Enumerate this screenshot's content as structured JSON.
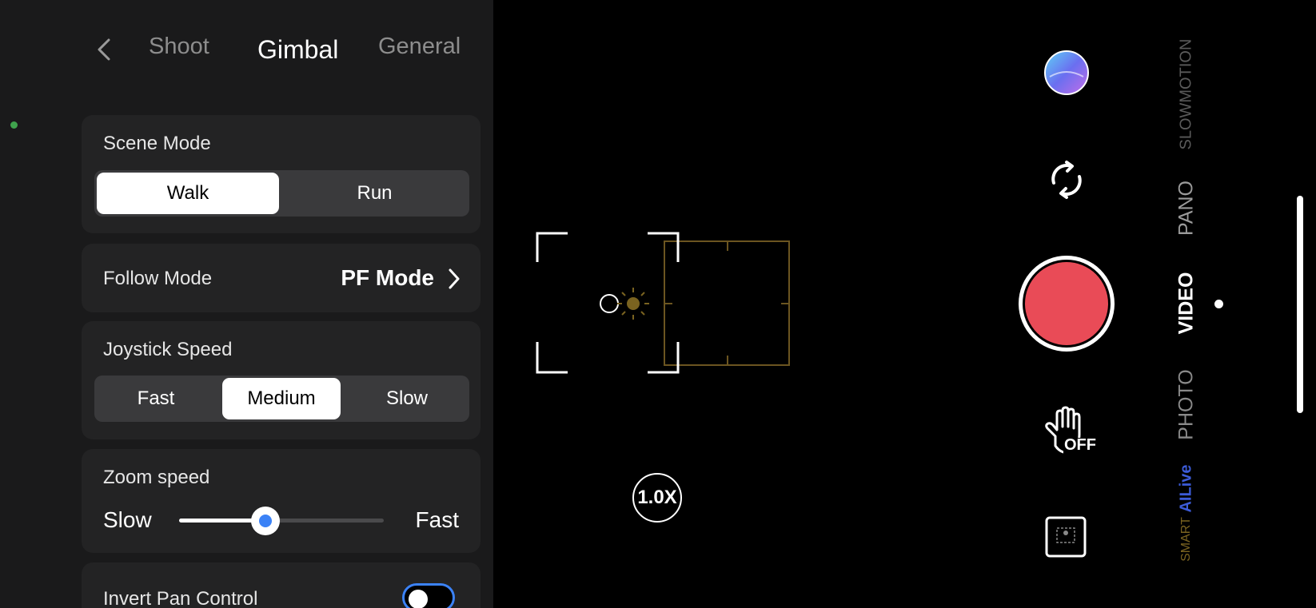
{
  "nav": {
    "tabs": [
      {
        "label": "Shoot"
      },
      {
        "label": "Gimbal"
      },
      {
        "label": "General"
      }
    ]
  },
  "settings": {
    "scene_mode": {
      "label": "Scene Mode",
      "options": [
        "Walk",
        "Run"
      ],
      "selected": "Walk"
    },
    "follow_mode": {
      "label": "Follow Mode",
      "value": "PF Mode"
    },
    "joystick_speed": {
      "label": "Joystick Speed",
      "options": [
        "Fast",
        "Medium",
        "Slow"
      ],
      "selected": "Medium"
    },
    "zoom_speed": {
      "label": "Zoom speed",
      "min_label": "Slow",
      "max_label": "Fast",
      "value_fraction": 0.42
    },
    "invert_pan": {
      "label": "Invert Pan Control",
      "enabled": false
    }
  },
  "camera": {
    "zoom": "1.0X",
    "gesture_control": "OFF",
    "modes": [
      "SMART",
      "AILive",
      "PHOTO",
      "VIDEO",
      "PANO",
      "SLOWMOTION"
    ],
    "active_mode": "VIDEO",
    "icons": {
      "gallery": "gallery-thumbnail-icon",
      "flip": "flip-camera-icon",
      "record": "record-button",
      "gesture": "hand-gesture-off-icon",
      "frame": "frame-template-icon"
    }
  },
  "colors": {
    "accent": "#3b82f6",
    "record": "#e94b57",
    "status_dot": "#3fa34d",
    "focus_box": "#6b5520",
    "ailive": "#3c5bd8",
    "smart": "#7a6320"
  }
}
